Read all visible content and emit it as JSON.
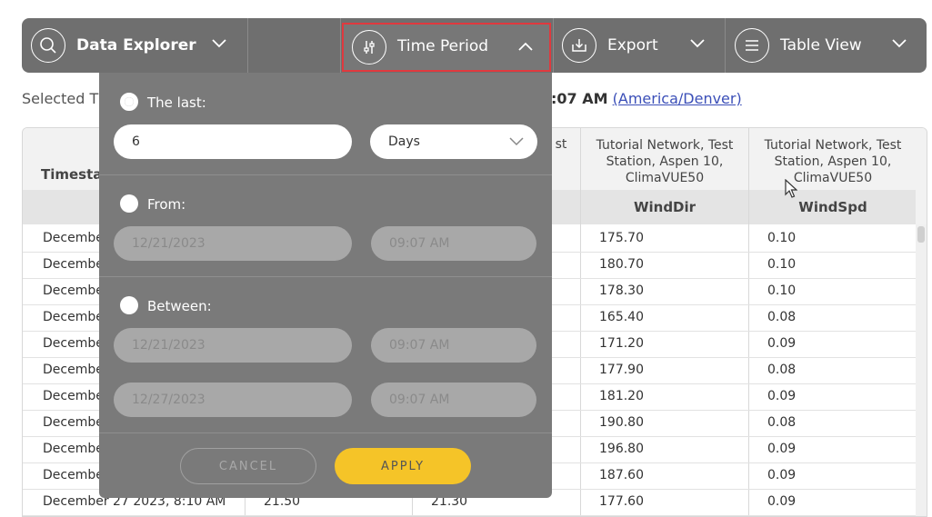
{
  "toolbar": {
    "data_explorer": "Data Explorer",
    "time_period": "Time Period",
    "export": "Export",
    "table_view": "Table View"
  },
  "selected": {
    "prefix": "Selected T",
    "time_suffix": ":07 AM",
    "timezone": "(America/Denver)"
  },
  "popover": {
    "last_label": "The last:",
    "last_value": "6",
    "unit": "Days",
    "from_label": "From:",
    "from_date": "12/21/2023",
    "from_time": "09:07 AM",
    "between_label": "Between:",
    "between_start_date": "12/21/2023",
    "between_start_time": "09:07 AM",
    "between_end_date": "12/27/2023",
    "between_end_time": "09:07 AM",
    "cancel": "CANCEL",
    "apply": "APPLY"
  },
  "table": {
    "timestamp_header": "Timestar",
    "partial_header": "st",
    "col1_source_line1": "Tutorial Network, Test",
    "col1_source_line2": "Station, Aspen 10,",
    "col1_source_line3": "ClimaVUE50",
    "col1_name": "WindDir",
    "col2_source_line1": "Tutorial Network, Test",
    "col2_source_line2": "Station, Aspen 10,",
    "col2_source_line3": "ClimaVUE50",
    "col2_name": "WindSpd",
    "rows": [
      {
        "ts": "Decembe",
        "winddir": "175.70",
        "windspd": "0.10"
      },
      {
        "ts": "Decembe",
        "winddir": "180.70",
        "windspd": "0.10"
      },
      {
        "ts": "Decembe",
        "winddir": "178.30",
        "windspd": "0.10"
      },
      {
        "ts": "Decembe",
        "winddir": "165.40",
        "windspd": "0.08"
      },
      {
        "ts": "Decembe",
        "winddir": "171.20",
        "windspd": "0.09"
      },
      {
        "ts": "Decembe",
        "winddir": "177.90",
        "windspd": "0.08"
      },
      {
        "ts": "Decembe",
        "winddir": "181.20",
        "windspd": "0.09"
      },
      {
        "ts": "Decembe",
        "winddir": "190.80",
        "windspd": "0.08"
      },
      {
        "ts": "Decembe",
        "winddir": "196.80",
        "windspd": "0.09"
      },
      {
        "ts": "Decembe",
        "winddir": "187.60",
        "windspd": "0.09"
      },
      {
        "ts": "December 27 2023, 8:10 AM",
        "c1": "21.50",
        "c2": "21.30",
        "winddir": "177.60",
        "windspd": "0.09"
      }
    ]
  }
}
